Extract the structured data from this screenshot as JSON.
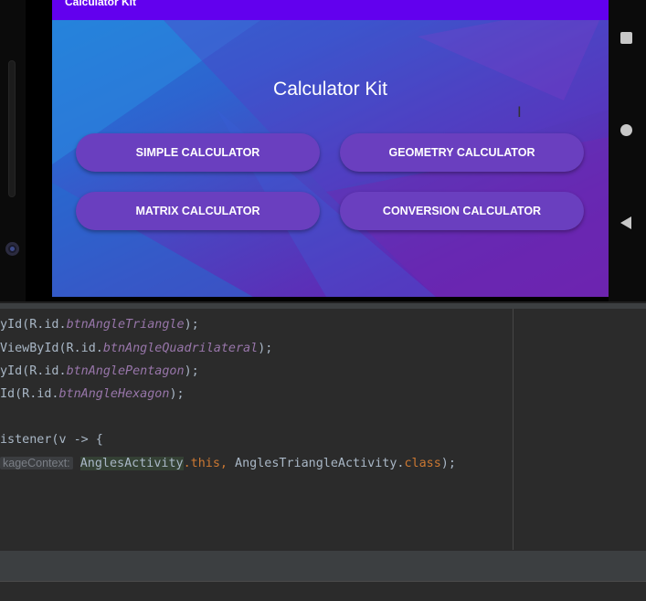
{
  "device": {
    "appbar_title": "Calculator Kit",
    "screen_title": "Calculator Kit",
    "buttons": {
      "simple": "SIMPLE CALCULATOR",
      "geometry": "GEOMETRY CALCULATOR",
      "matrix": "MATRIX CALCULATOR",
      "conversion": "CONVERSION CALCULATOR"
    },
    "text_cursor": "I"
  },
  "editor": {
    "line1": {
      "pre": "yId(R.id.",
      "field": "btnAngleTriangle",
      "post": ");"
    },
    "line2": {
      "pre": "ViewById(R.id.",
      "field": "btnAngleQuadrilateral",
      "post": ");"
    },
    "line3": {
      "pre": "yId(R.id.",
      "field": "btnAnglePentagon",
      "post": ");"
    },
    "line4": {
      "pre": "Id(R.id.",
      "field": "btnAngleHexagon",
      "post": ");"
    },
    "line5": {
      "text": "istener(v -> {"
    },
    "line6": {
      "hint": "kageContext:",
      "hl": "AnglesActivity",
      "this_kw": ".this,",
      "mid": " AnglesTriangleActivity.",
      "class_kw": "class",
      "end": ");"
    }
  },
  "colors": {
    "appbar": "#6200ee",
    "button": "#6a3fbf",
    "editor_bg": "#2b2b2b",
    "field": "#9876aa",
    "keyword": "#cc7832"
  }
}
